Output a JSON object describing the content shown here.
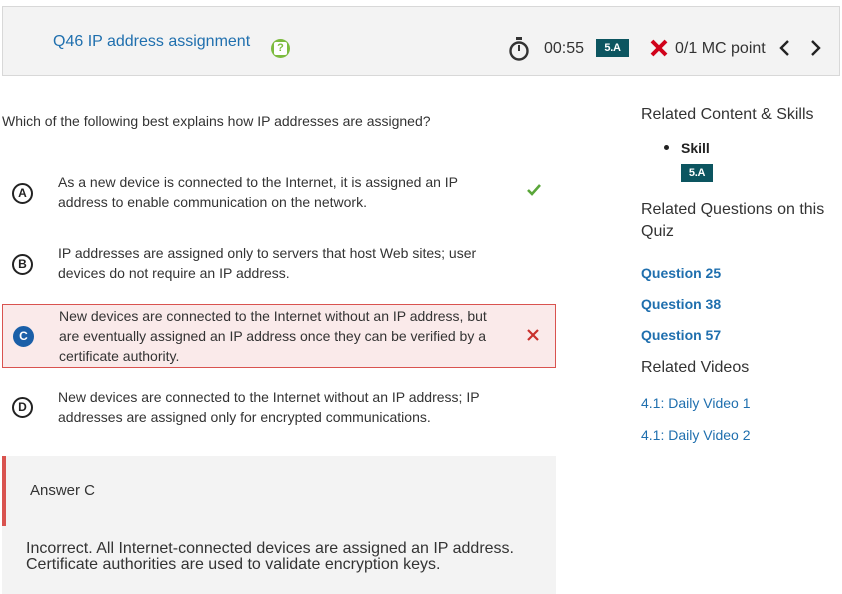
{
  "header": {
    "title": "Q46 IP address assignment",
    "help_icon": "help-icon",
    "timer": "00:55",
    "skill_badge": "5.A",
    "points": "0/1 MC point",
    "prev_icon": "chevron-left-icon",
    "next_icon": "chevron-right-icon"
  },
  "question": "Which of the following best explains how IP addresses are assigned?",
  "options": [
    {
      "letter": "A",
      "text": "As a new device is connected to the Internet, it is assigned an IP address to enable communication on the network.",
      "state": "correct"
    },
    {
      "letter": "B",
      "text": "IP addresses are assigned only to servers that host Web sites; user devices do not require an IP address.",
      "state": "none"
    },
    {
      "letter": "C",
      "text": "New devices are connected to the Internet without an IP address, but are eventually assigned an IP address once they can be verified by a certificate authority.",
      "state": "selected-incorrect"
    },
    {
      "letter": "D",
      "text": "New devices are connected to the Internet without an IP address; IP addresses are assigned only for encrypted communications.",
      "state": "none"
    }
  ],
  "answer": {
    "label": "Answer C",
    "explanation": "Incorrect. All Internet-connected devices are assigned an IP address. Certificate authorities are used to validate encryption keys."
  },
  "sidebar": {
    "related_heading": "Related Content & Skills",
    "skill_label": "Skill",
    "skill_badge": "5.A",
    "questions_heading": "Related Questions on this Quiz",
    "questions": [
      "Question 25",
      "Question 38",
      "Question 57"
    ],
    "videos_heading": "Related Videos",
    "videos": [
      "4.1: Daily Video 1",
      "4.1: Daily Video 2"
    ]
  },
  "colors": {
    "accent_blue": "#1f6fae",
    "badge_teal": "#0c5560",
    "correct_green": "#7cbb3e",
    "incorrect_red": "#d9534f"
  }
}
